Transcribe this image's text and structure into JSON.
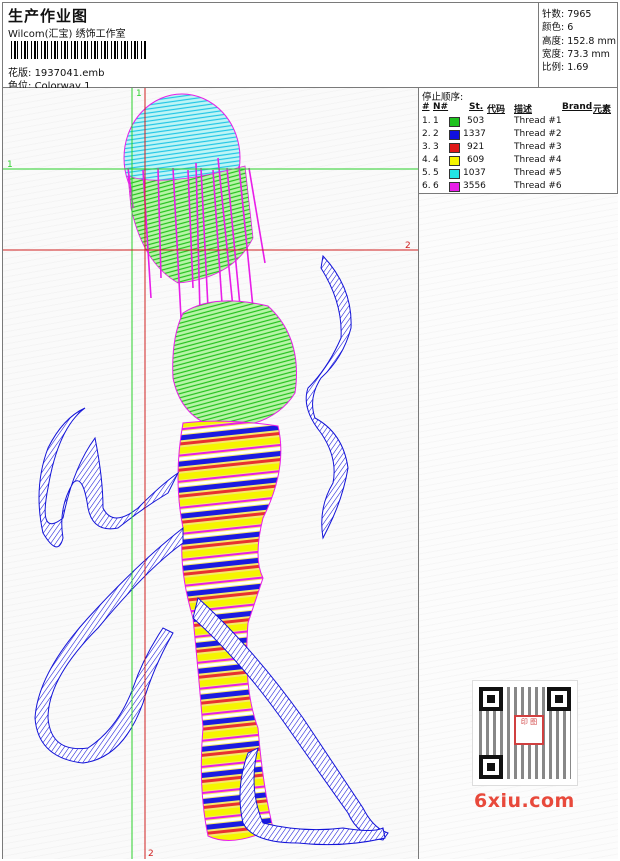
{
  "header": {
    "title": "生产作业图",
    "subtitle": "Wilcom(汇宝) 绣饰工作室",
    "design_label": "花版:",
    "design_value": "1937041.emb",
    "colorway_label": "色位:",
    "colorway_value": "Colorway 1"
  },
  "stats": {
    "stitches_label": "针数:",
    "stitches_value": "7965",
    "colors_label": "颜色:",
    "colors_value": "6",
    "height_label": "高度:",
    "height_value": "152.8 mm",
    "width_label": "宽度:",
    "width_value": "73.3 mm",
    "ratio_label": "比例:",
    "ratio_value": "1.69"
  },
  "stop_sequence": {
    "title": "停止顺序:",
    "headers": {
      "num": "#",
      "n": "N#",
      "st": "St.",
      "code": "代码",
      "desc": "描述",
      "brand": "Brand",
      "element": "元素"
    },
    "rows": [
      {
        "num": "1.",
        "n": "1",
        "color": "#1ec21e",
        "code": "503",
        "desc": "Thread #1"
      },
      {
        "num": "2.",
        "n": "2",
        "color": "#1010e0",
        "code": "1337",
        "desc": "Thread #2"
      },
      {
        "num": "3.",
        "n": "3",
        "color": "#e01818",
        "code": "921",
        "desc": "Thread #3"
      },
      {
        "num": "4.",
        "n": "4",
        "color": "#f5f500",
        "code": "609",
        "desc": "Thread #4"
      },
      {
        "num": "5.",
        "n": "5",
        "color": "#22e6e6",
        "code": "1037",
        "desc": "Thread #5"
      },
      {
        "num": "6.",
        "n": "6",
        "color": "#e81ee8",
        "code": "3556",
        "desc": "Thread #6"
      }
    ]
  },
  "canvas": {
    "guide_labels": [
      "1",
      "1",
      "2",
      "2"
    ]
  },
  "watermark": {
    "text": "6xiu.com",
    "seal_text": "印 图"
  },
  "icons": {
    "qr": "qr-code-icon",
    "barcode": "barcode-icon"
  }
}
